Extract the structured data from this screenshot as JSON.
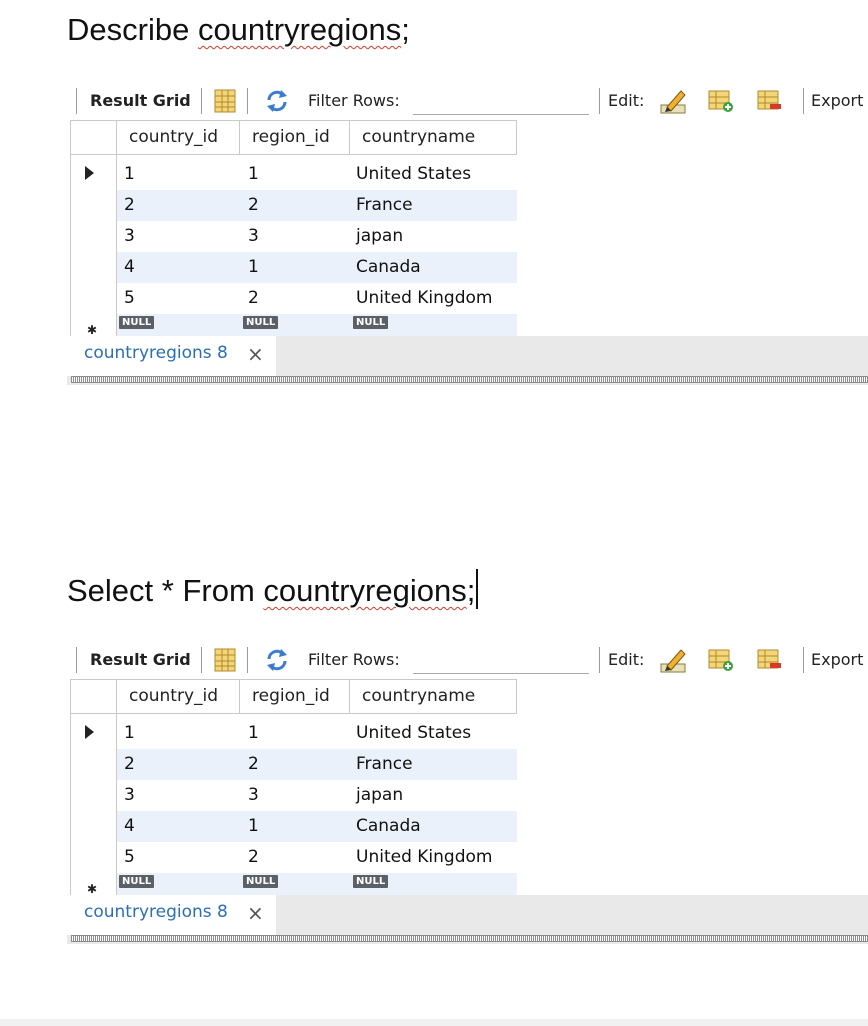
{
  "document": {
    "query1": {
      "keyword": "Describe ",
      "target": "countryregions",
      "suffix": ";"
    },
    "query2": {
      "keyword": "Select * From ",
      "target": "countryregions",
      "suffix": ";"
    }
  },
  "result_panel": {
    "toolbar": {
      "result_grid_label": "Result Grid",
      "filter_rows_label": "Filter Rows:",
      "filter_value": "",
      "edit_label": "Edit:",
      "export_label": "Export"
    },
    "columns": [
      "country_id",
      "region_id",
      "countryname"
    ],
    "rows": [
      [
        "1",
        "1",
        "United States"
      ],
      [
        "2",
        "2",
        "France"
      ],
      [
        "3",
        "3",
        "japan"
      ],
      [
        "4",
        "1",
        "Canada"
      ],
      [
        "5",
        "2",
        "United Kingdom"
      ]
    ],
    "null_label": "NULL",
    "tab": {
      "label": "countryregions 8",
      "close_glyph": "×"
    }
  },
  "icons": {
    "grid_toggle": "grid-layout-icon",
    "refresh": "refresh-icon",
    "edit": "edit-pencil-icon",
    "add_row": "add-row-icon",
    "delete_row": "delete-row-icon",
    "current_row": "row-pointer-icon",
    "new_row": "new-row-star-icon"
  },
  "colors": {
    "alt_row": "#eaf1fb",
    "tab_text": "#2a6fb4",
    "null_badge": "#5b6066",
    "spell_underline": "#d43a2a"
  }
}
